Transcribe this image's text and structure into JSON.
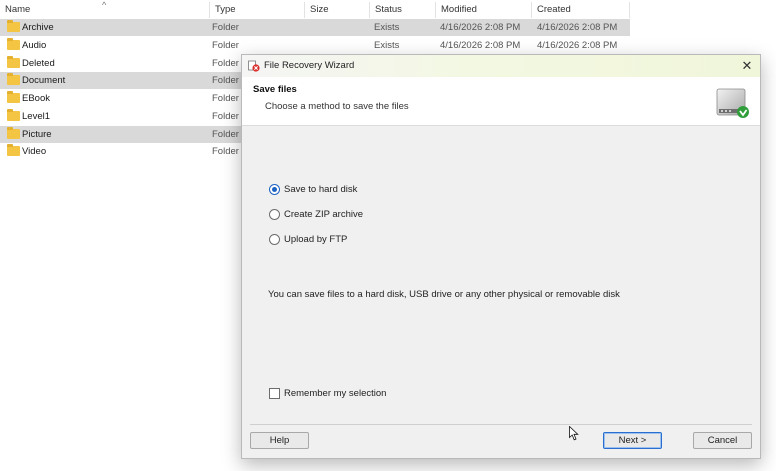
{
  "file_list": {
    "columns": [
      "Name",
      "Type",
      "Size",
      "Status",
      "Modified",
      "Created"
    ],
    "sort_indicator": "^",
    "rows": [
      {
        "name": "Archive",
        "type": "Folder",
        "size": "",
        "status": "Exists",
        "modified": "4/16/2026 2:08 PM",
        "created": "4/16/2026 2:08 PM",
        "selected": true
      },
      {
        "name": "Audio",
        "type": "Folder",
        "size": "",
        "status": "Exists",
        "modified": "4/16/2026 2:08 PM",
        "created": "4/16/2026 2:08 PM",
        "selected": false
      },
      {
        "name": "Deleted",
        "type": "Folder",
        "size": "",
        "status": "",
        "modified": "",
        "created": "",
        "selected": false
      },
      {
        "name": "Document",
        "type": "Folder",
        "size": "",
        "status": "",
        "modified": "",
        "created": "",
        "selected": true
      },
      {
        "name": "EBook",
        "type": "Folder",
        "size": "",
        "status": "",
        "modified": "",
        "created": "",
        "selected": false
      },
      {
        "name": "Level1",
        "type": "Folder",
        "size": "",
        "status": "",
        "modified": "",
        "created": "",
        "selected": false
      },
      {
        "name": "Picture",
        "type": "Folder",
        "size": "",
        "status": "",
        "modified": "",
        "created": "",
        "selected": true
      },
      {
        "name": "Video",
        "type": "Folder",
        "size": "",
        "status": "",
        "modified": "",
        "created": "",
        "selected": false
      }
    ]
  },
  "dialog": {
    "title": "File Recovery Wizard",
    "close_glyph": "✕",
    "heading": "Save files",
    "subheading": "Choose a method to save the files",
    "options": [
      {
        "label": "Save to hard disk",
        "selected": true
      },
      {
        "label": "Create ZIP archive",
        "selected": false
      },
      {
        "label": "Upload by FTP",
        "selected": false
      }
    ],
    "info": "You can save files to a hard disk, USB drive or any other physical or removable disk",
    "remember_label": "Remember my selection",
    "remember_checked": false,
    "buttons": {
      "help": "Help",
      "next": "Next >",
      "cancel": "Cancel"
    }
  },
  "colors": {
    "selection": "#d9d9d9",
    "accent": "#1c62c4",
    "folder": "#f4c542",
    "dialog_bg": "#f0f0f0"
  },
  "icons": {
    "folder": "folder-icon",
    "app": "file-recovery-icon",
    "disk": "hard-disk-icon",
    "close": "close-icon"
  }
}
